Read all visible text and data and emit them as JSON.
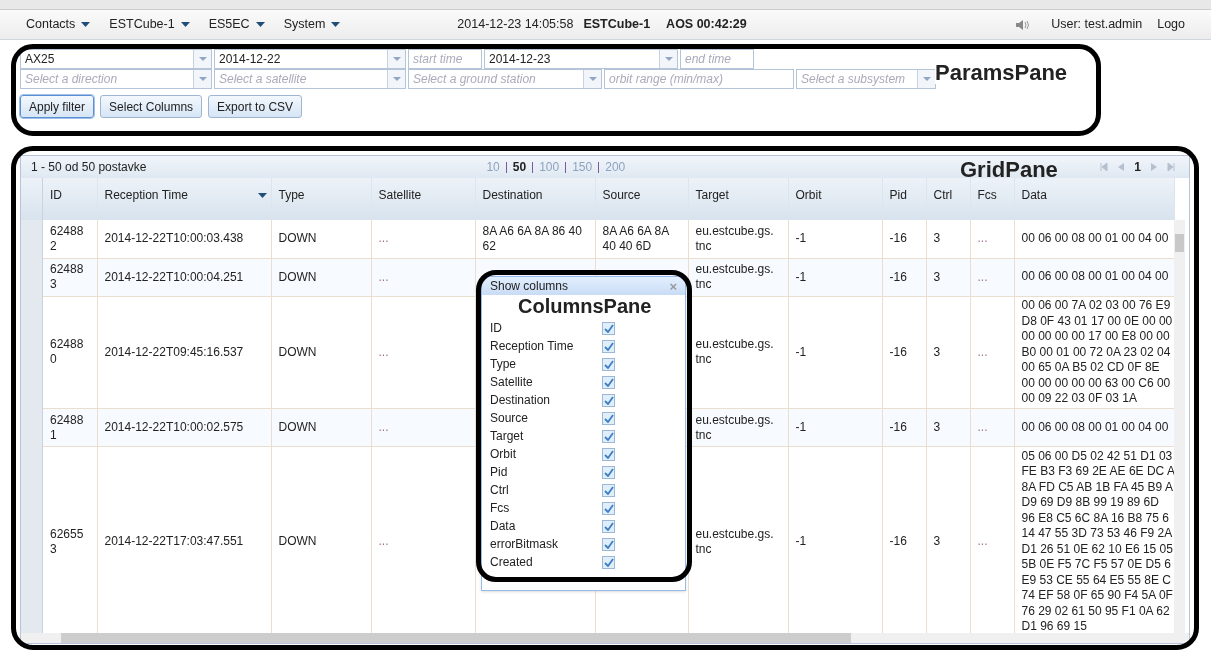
{
  "menu": [
    {
      "label": "Contacts"
    },
    {
      "label": "ESTCube-1"
    },
    {
      "label": "ES5EC"
    },
    {
      "label": "System"
    }
  ],
  "status": {
    "clock": "2014-12-23 14:05:58",
    "satellite": "ESTCube-1",
    "aos": "AOS 00:42:29",
    "user": "User: test.admin",
    "logout": "Logo"
  },
  "params": {
    "filters": [
      {
        "kind": "select",
        "value": "AX25"
      },
      {
        "kind": "select",
        "value": "2014-12-22"
      },
      {
        "kind": "text",
        "placeholder": "start time"
      },
      {
        "kind": "select",
        "value": "2014-12-23"
      },
      {
        "kind": "text",
        "placeholder": "end time"
      },
      {
        "kind": "select",
        "placeholder": "Select a direction"
      },
      {
        "kind": "select",
        "placeholder": "Select a satellite"
      },
      {
        "kind": "select",
        "placeholder": "Select a ground station"
      },
      {
        "kind": "text",
        "placeholder": "orbit range (min/max)"
      },
      {
        "kind": "select",
        "placeholder": "Select a subsystem"
      }
    ],
    "buttons": [
      {
        "label": "Apply filter",
        "focused": true
      },
      {
        "label": "Select Columns",
        "focused": false
      },
      {
        "label": "Export to CSV",
        "focused": false
      }
    ]
  },
  "grid": {
    "summary": "1 - 50 od 50 postavke",
    "page_sizes": [
      {
        "label": "10",
        "selected": false
      },
      {
        "label": "50",
        "selected": true
      },
      {
        "label": "100",
        "selected": false
      },
      {
        "label": "150",
        "selected": false
      },
      {
        "label": "200",
        "selected": false
      }
    ],
    "page": "1",
    "columns": [
      {
        "label": "ID",
        "sorted": false
      },
      {
        "label": "Reception Time",
        "sorted": true
      },
      {
        "label": "Type",
        "sorted": false
      },
      {
        "label": "Satellite",
        "sorted": false
      },
      {
        "label": "Destination",
        "sorted": false
      },
      {
        "label": "Source",
        "sorted": false
      },
      {
        "label": "Target",
        "sorted": false
      },
      {
        "label": "Orbit",
        "sorted": false
      },
      {
        "label": "Pid",
        "sorted": false
      },
      {
        "label": "Ctrl",
        "sorted": false
      },
      {
        "label": "Fcs",
        "sorted": false
      },
      {
        "label": "Data",
        "sorted": false
      }
    ],
    "rows": [
      {
        "cells": [
          "624882",
          "2014-12-22T10:00:03.438",
          "DOWN",
          "...",
          "8A A6 6A 8A 86 40 62",
          "8A A6 6A 8A 40 40 6D",
          "eu.estcube.gs. tnc",
          "-1",
          "-16",
          "3",
          "..."
        ],
        "data": [
          "00 06 00 08 00 01 00 04 00"
        ]
      },
      {
        "cells": [
          "624883",
          "2014-12-22T10:00:04.251",
          "DOWN",
          "...",
          "",
          "",
          "eu.estcube.gs. tnc",
          "-1",
          "-16",
          "3",
          "..."
        ],
        "data": [
          "00 06 00 08 00 01 00 04 00"
        ]
      },
      {
        "cells": [
          "624880",
          "2014-12-22T09:45:16.537",
          "DOWN",
          "...",
          "",
          "",
          "eu.estcube.gs. tnc",
          "-1",
          "-16",
          "3",
          "..."
        ],
        "data": [
          "00 06 00 7A 02 03 00 76 E9",
          "D8 0F 43 01 17 00 0E 00 00",
          "00 00 00 00 17 00 E8 00 00",
          "B0 00 01 00 72 0A 23 02 04",
          "00 65 0A B5 02 CD 0F 8E",
          "00 00 00 00 00 63 00 C6 00",
          "00 09 22 03 0F 03 1A"
        ]
      },
      {
        "cells": [
          "624881",
          "2014-12-22T10:00:02.575",
          "DOWN",
          "...",
          "",
          "",
          "eu.estcube.gs. tnc",
          "-1",
          "-16",
          "3",
          "..."
        ],
        "data": [
          "00 06 00 08 00 01 00 04 00"
        ]
      },
      {
        "cells": [
          "626553",
          "2014-12-22T17:03:47.551",
          "DOWN",
          "...",
          "",
          "",
          "eu.estcube.gs. tnc",
          "-1",
          "-16",
          "3",
          "..."
        ],
        "data": [
          "05 06 00 D5 02 42 51 D1 03",
          "FE B3 F3 69 2E AE 6E DC A",
          "8A FD C5 AB 1B FA 45 B9 A",
          "D9 69 D9 8B 99 19 89 6D",
          "96 E8 C5 6C 8A 16 B8 75 6",
          "14 47 55 3D 73 53 46 F9 2A",
          "D1 26 51 0E 62 10 E6 15 05",
          "5B 0E F5 7C F5 57 0E D5 6",
          "E9 53 CE 55 64 E5 55 8E C",
          "74 EF 58 0F 65 90 F4 5A 0F",
          "76 29 02 61 50 95 F1 0A 62",
          "D1 96 69 15"
        ]
      }
    ]
  },
  "columns_popup": {
    "title": "Show columns",
    "close": "×",
    "items": [
      {
        "label": "ID",
        "checked": true
      },
      {
        "label": "Reception Time",
        "checked": true
      },
      {
        "label": "Type",
        "checked": true
      },
      {
        "label": "Satellite",
        "checked": true
      },
      {
        "label": "Destination",
        "checked": true
      },
      {
        "label": "Source",
        "checked": true
      },
      {
        "label": "Target",
        "checked": true
      },
      {
        "label": "Orbit",
        "checked": true
      },
      {
        "label": "Pid",
        "checked": true
      },
      {
        "label": "Ctrl",
        "checked": true
      },
      {
        "label": "Fcs",
        "checked": true
      },
      {
        "label": "Data",
        "checked": true
      },
      {
        "label": "errorBitmask",
        "checked": true
      },
      {
        "label": "Created",
        "checked": true
      }
    ]
  },
  "annotations": {
    "params": "ParamsPane",
    "grid": "GridPane",
    "columns": "ColumnsPane"
  }
}
